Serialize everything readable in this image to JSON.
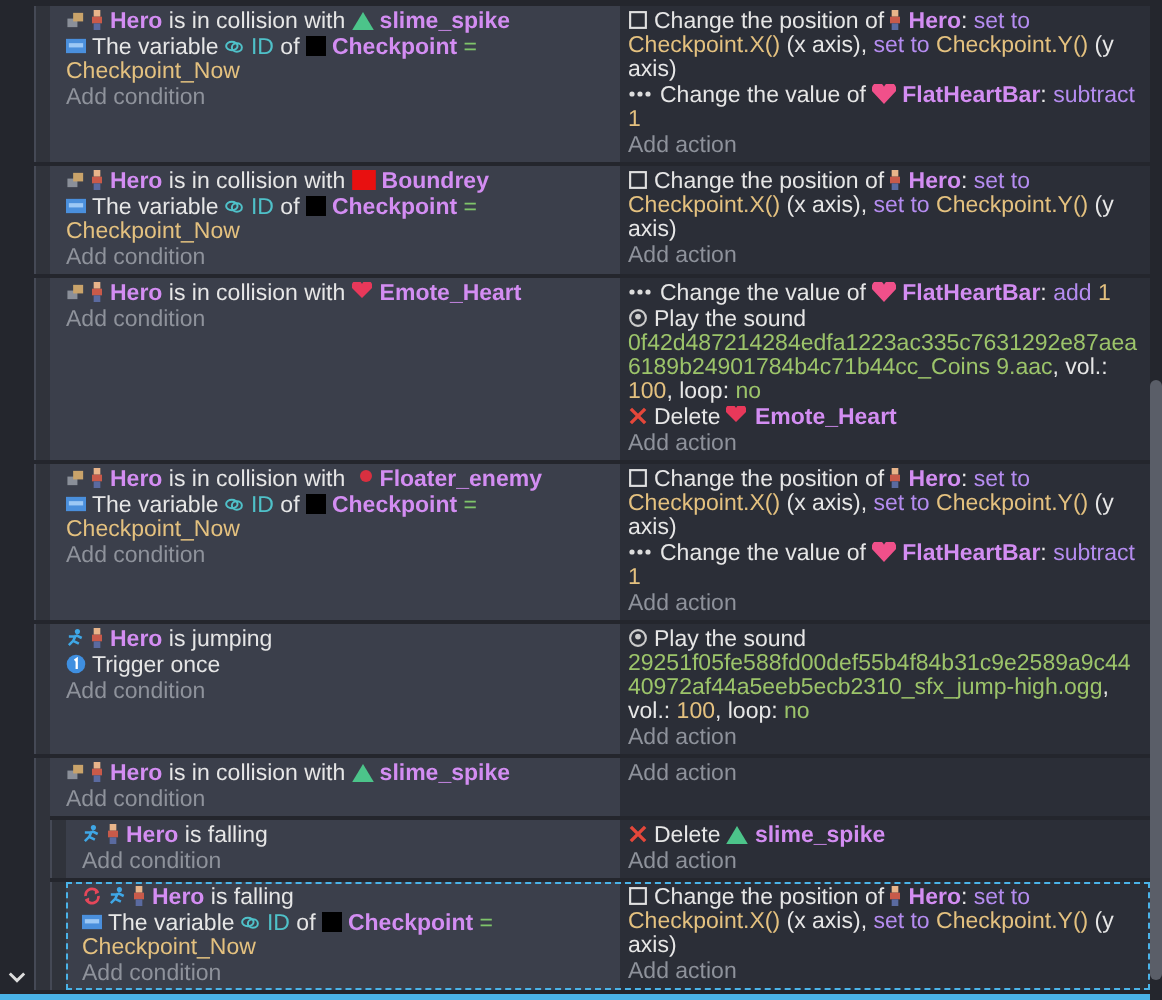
{
  "events": [
    {
      "selected": false,
      "add_condition": "Add condition",
      "add_action": "Add action",
      "conditions": [
        {
          "kind": "collision",
          "parts": [
            {
              "t": "Hero",
              "kind": "sprite"
            },
            {
              "t": " is in collision with ",
              "kind": "text"
            },
            {
              "t": "slime_spike",
              "kind": "slime"
            }
          ]
        },
        {
          "kind": "variable",
          "parts": [
            {
              "t": "The variable ",
              "kind": "text"
            },
            {
              "t": "ID",
              "kind": "variable"
            },
            {
              "t": " of ",
              "kind": "text"
            },
            {
              "t": "Checkpoint",
              "kind": "square"
            },
            {
              "t": " = ",
              "kind": "operator"
            },
            {
              "t": "Checkpoint_Now",
              "kind": "param"
            }
          ]
        }
      ],
      "actions": [
        {
          "kind": "position",
          "parts": [
            {
              "t": "Change the position of ",
              "kind": "text"
            },
            {
              "t": "Hero",
              "kind": "sprite"
            },
            {
              "t": ": ",
              "kind": "text"
            },
            {
              "t": "set to",
              "kind": "keyword"
            },
            {
              "t": "Checkpoint.X()",
              "kind": "param"
            },
            {
              "t": " (x axis), ",
              "kind": "text"
            },
            {
              "t": "set to",
              "kind": "keyword"
            },
            {
              "t": "Checkpoint.Y()",
              "kind": "param"
            },
            {
              "t": " (y axis)",
              "kind": "text"
            }
          ]
        },
        {
          "kind": "value",
          "parts": [
            {
              "t": "Change the value of ",
              "kind": "text"
            },
            {
              "t": "FlatHeartBar",
              "kind": "bar"
            },
            {
              "t": ": ",
              "kind": "text"
            },
            {
              "t": "subtract",
              "kind": "keyword"
            },
            {
              "t": "1",
              "kind": "param"
            }
          ]
        }
      ]
    },
    {
      "selected": false,
      "add_condition": "Add condition",
      "add_action": "Add action",
      "conditions": [
        {
          "kind": "collision",
          "parts": [
            {
              "t": "Hero",
              "kind": "sprite"
            },
            {
              "t": " is in collision with ",
              "kind": "text"
            },
            {
              "t": "Boundrey",
              "kind": "block"
            }
          ]
        },
        {
          "kind": "variable",
          "parts": [
            {
              "t": "The variable ",
              "kind": "text"
            },
            {
              "t": "ID",
              "kind": "variable"
            },
            {
              "t": " of ",
              "kind": "text"
            },
            {
              "t": "Checkpoint",
              "kind": "square"
            },
            {
              "t": " = ",
              "kind": "operator"
            },
            {
              "t": "Checkpoint_Now",
              "kind": "param"
            }
          ]
        }
      ],
      "actions": [
        {
          "kind": "position",
          "parts": [
            {
              "t": "Change the position of ",
              "kind": "text"
            },
            {
              "t": "Hero",
              "kind": "sprite"
            },
            {
              "t": ": ",
              "kind": "text"
            },
            {
              "t": "set to",
              "kind": "keyword"
            },
            {
              "t": "Checkpoint.X()",
              "kind": "param"
            },
            {
              "t": " (x axis), ",
              "kind": "text"
            },
            {
              "t": "set to",
              "kind": "keyword"
            },
            {
              "t": "Checkpoint.Y()",
              "kind": "param"
            },
            {
              "t": " (y axis)",
              "kind": "text"
            }
          ]
        }
      ]
    },
    {
      "selected": false,
      "add_condition": "Add condition",
      "add_action": "Add action",
      "conditions": [
        {
          "kind": "collision",
          "parts": [
            {
              "t": "Hero",
              "kind": "sprite"
            },
            {
              "t": " is in collision with ",
              "kind": "text"
            },
            {
              "t": "Emote_Heart",
              "kind": "heart"
            }
          ]
        }
      ],
      "actions": [
        {
          "kind": "value",
          "parts": [
            {
              "t": "Change the value of ",
              "kind": "text"
            },
            {
              "t": "FlatHeartBar",
              "kind": "bar"
            },
            {
              "t": ": ",
              "kind": "text"
            },
            {
              "t": "add",
              "kind": "keyword"
            },
            {
              "t": "1",
              "kind": "param"
            }
          ]
        },
        {
          "kind": "sound",
          "parts": [
            {
              "t": "Play the sound ",
              "kind": "text"
            },
            {
              "t": "0f42d487214284edfa1223ac335c7631292e87aea6189b24901784b4c71b44cc_Coins 9.aac",
              "kind": "string"
            },
            {
              "t": ", vol.: ",
              "kind": "text"
            },
            {
              "t": "100",
              "kind": "param"
            },
            {
              "t": ", loop: ",
              "kind": "text"
            },
            {
              "t": "no",
              "kind": "string"
            }
          ]
        },
        {
          "kind": "delete",
          "parts": [
            {
              "t": "Delete ",
              "kind": "text"
            },
            {
              "t": "Emote_Heart",
              "kind": "heart"
            }
          ]
        }
      ]
    },
    {
      "selected": false,
      "add_condition": "Add condition",
      "add_action": "Add action",
      "conditions": [
        {
          "kind": "collision",
          "parts": [
            {
              "t": "Hero",
              "kind": "sprite"
            },
            {
              "t": " is in collision with ",
              "kind": "text"
            },
            {
              "t": "Floater_enemy",
              "kind": "enemy"
            }
          ]
        },
        {
          "kind": "variable",
          "parts": [
            {
              "t": "The variable ",
              "kind": "text"
            },
            {
              "t": "ID",
              "kind": "variable"
            },
            {
              "t": " of ",
              "kind": "text"
            },
            {
              "t": "Checkpoint",
              "kind": "square"
            },
            {
              "t": " = ",
              "kind": "operator"
            },
            {
              "t": "Checkpoint_Now",
              "kind": "param"
            }
          ]
        }
      ],
      "actions": [
        {
          "kind": "position",
          "parts": [
            {
              "t": "Change the position of ",
              "kind": "text"
            },
            {
              "t": "Hero",
              "kind": "sprite"
            },
            {
              "t": ": ",
              "kind": "text"
            },
            {
              "t": "set to",
              "kind": "keyword"
            },
            {
              "t": "Checkpoint.X()",
              "kind": "param"
            },
            {
              "t": " (x axis), ",
              "kind": "text"
            },
            {
              "t": "set to",
              "kind": "keyword"
            },
            {
              "t": "Checkpoint.Y()",
              "kind": "param"
            },
            {
              "t": " (y axis)",
              "kind": "text"
            }
          ]
        },
        {
          "kind": "value",
          "parts": [
            {
              "t": "Change the value of ",
              "kind": "text"
            },
            {
              "t": "FlatHeartBar",
              "kind": "bar"
            },
            {
              "t": ": ",
              "kind": "text"
            },
            {
              "t": "subtract",
              "kind": "keyword"
            },
            {
              "t": "1",
              "kind": "param"
            }
          ]
        }
      ]
    },
    {
      "selected": false,
      "add_condition": "Add condition",
      "add_action": "Add action",
      "conditions": [
        {
          "kind": "jumping",
          "parts": [
            {
              "t": "Hero",
              "kind": "sprite"
            },
            {
              "t": " is jumping",
              "kind": "text"
            }
          ]
        },
        {
          "kind": "trigger",
          "parts": [
            {
              "t": "Trigger once",
              "kind": "text"
            }
          ]
        }
      ],
      "actions": [
        {
          "kind": "sound",
          "parts": [
            {
              "t": "Play the sound ",
              "kind": "text"
            },
            {
              "t": "29251f05fe588fd00def55b4f84b31c9e2589a9c4440972af44a5eeb5ecb2310_sfx_jump-high.ogg",
              "kind": "string"
            },
            {
              "t": ", vol.: ",
              "kind": "text"
            },
            {
              "t": "100",
              "kind": "param"
            },
            {
              "t": ", loop: ",
              "kind": "text"
            },
            {
              "t": "no",
              "kind": "string"
            }
          ]
        }
      ]
    },
    {
      "selected": false,
      "expanded": true,
      "add_condition": "Add condition",
      "add_action": "Add action",
      "conditions": [
        {
          "kind": "collision",
          "parts": [
            {
              "t": "Hero",
              "kind": "sprite"
            },
            {
              "t": " is in collision with ",
              "kind": "text"
            },
            {
              "t": "slime_spike",
              "kind": "slime"
            }
          ]
        }
      ],
      "children": [
        {
          "selected": false,
          "add_condition": "Add condition",
          "add_action": "Add action",
          "conditions": [
            {
              "kind": "falling",
              "parts": [
                {
                  "t": "Hero",
                  "kind": "sprite"
                },
                {
                  "t": " is falling",
                  "kind": "text"
                }
              ]
            }
          ],
          "actions": [
            {
              "kind": "delete",
              "parts": [
                {
                  "t": "Delete ",
                  "kind": "text"
                },
                {
                  "t": "slime_spike",
                  "kind": "slime"
                }
              ]
            }
          ]
        },
        {
          "selected": true,
          "add_condition": "Add condition",
          "add_action": "Add action",
          "conditions": [
            {
              "kind": "repeatfalling",
              "parts": [
                {
                  "t": "Hero",
                  "kind": "sprite"
                },
                {
                  "t": " is falling",
                  "kind": "text"
                }
              ]
            },
            {
              "kind": "variable",
              "parts": [
                {
                  "t": "The variable ",
                  "kind": "text"
                },
                {
                  "t": "ID",
                  "kind": "variable"
                },
                {
                  "t": " of ",
                  "kind": "text"
                },
                {
                  "t": "Checkpoint",
                  "kind": "square"
                },
                {
                  "t": " = ",
                  "kind": "operator"
                },
                {
                  "t": "Checkpoint_Now",
                  "kind": "param"
                }
              ]
            }
          ],
          "actions": [
            {
              "kind": "position",
              "parts": [
                {
                  "t": "Change the position of ",
                  "kind": "text"
                },
                {
                  "t": "Hero",
                  "kind": "sprite"
                },
                {
                  "t": ": ",
                  "kind": "text"
                },
                {
                  "t": "set to",
                  "kind": "keyword"
                },
                {
                  "t": "Checkpoint.X()",
                  "kind": "param"
                },
                {
                  "t": " (x axis), ",
                  "kind": "text"
                },
                {
                  "t": "set to",
                  "kind": "keyword"
                },
                {
                  "t": "Checkpoint.Y()",
                  "kind": "param"
                },
                {
                  "t": " (y axis)",
                  "kind": "text"
                }
              ]
            }
          ]
        }
      ]
    }
  ]
}
